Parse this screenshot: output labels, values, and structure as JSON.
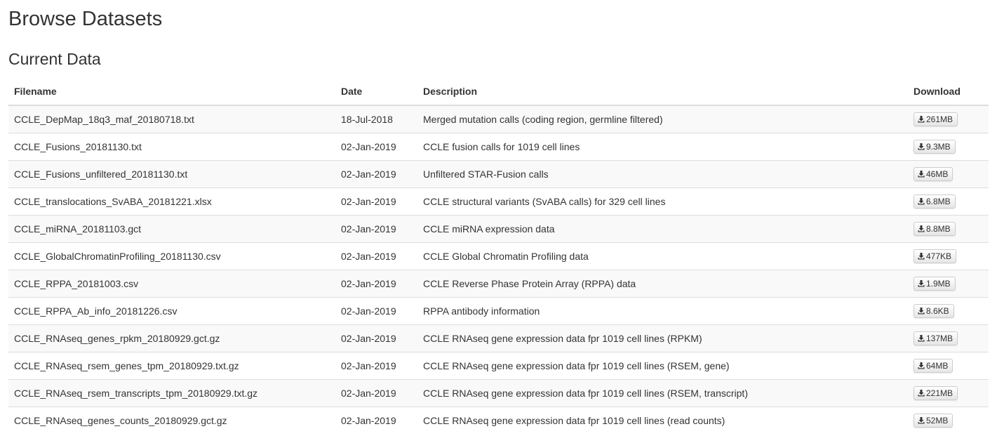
{
  "page_title": "Browse Datasets",
  "section_title": "Current Data",
  "icons": {
    "download": "download-icon"
  },
  "table": {
    "headers": {
      "filename": "Filename",
      "date": "Date",
      "description": "Description",
      "download": "Download"
    },
    "rows": [
      {
        "filename": "CCLE_DepMap_18q3_maf_20180718.txt",
        "date": "18-Jul-2018",
        "description": "Merged mutation calls (coding region, germline filtered)",
        "size": "261MB"
      },
      {
        "filename": "CCLE_Fusions_20181130.txt",
        "date": "02-Jan-2019",
        "description": "CCLE fusion calls for 1019 cell lines",
        "size": "9.3MB"
      },
      {
        "filename": "CCLE_Fusions_unfiltered_20181130.txt",
        "date": "02-Jan-2019",
        "description": "Unfiltered STAR-Fusion calls",
        "size": "46MB"
      },
      {
        "filename": "CCLE_translocations_SvABA_20181221.xlsx",
        "date": "02-Jan-2019",
        "description": "CCLE structural variants (SvABA calls) for 329 cell lines",
        "size": "6.8MB"
      },
      {
        "filename": "CCLE_miRNA_20181103.gct",
        "date": "02-Jan-2019",
        "description": "CCLE miRNA expression data",
        "size": "8.8MB"
      },
      {
        "filename": "CCLE_GlobalChromatinProfiling_20181130.csv",
        "date": "02-Jan-2019",
        "description": "CCLE Global Chromatin Profiling data",
        "size": "477KB"
      },
      {
        "filename": "CCLE_RPPA_20181003.csv",
        "date": "02-Jan-2019",
        "description": "CCLE Reverse Phase Protein Array (RPPA) data",
        "size": "1.9MB"
      },
      {
        "filename": "CCLE_RPPA_Ab_info_20181226.csv",
        "date": "02-Jan-2019",
        "description": "RPPA antibody information",
        "size": "8.6KB"
      },
      {
        "filename": "CCLE_RNAseq_genes_rpkm_20180929.gct.gz",
        "date": "02-Jan-2019",
        "description": "CCLE RNAseq gene expression data fpr 1019 cell lines (RPKM)",
        "size": "137MB"
      },
      {
        "filename": "CCLE_RNAseq_rsem_genes_tpm_20180929.txt.gz",
        "date": "02-Jan-2019",
        "description": "CCLE RNAseq gene expression data fpr 1019 cell lines (RSEM, gene)",
        "size": "64MB"
      },
      {
        "filename": "CCLE_RNAseq_rsem_transcripts_tpm_20180929.txt.gz",
        "date": "02-Jan-2019",
        "description": "CCLE RNAseq gene expression data fpr 1019 cell lines (RSEM, transcript)",
        "size": "221MB"
      },
      {
        "filename": "CCLE_RNAseq_genes_counts_20180929.gct.gz",
        "date": "02-Jan-2019",
        "description": "CCLE RNAseq gene expression data fpr 1019 cell lines (read counts)",
        "size": "52MB"
      }
    ]
  }
}
